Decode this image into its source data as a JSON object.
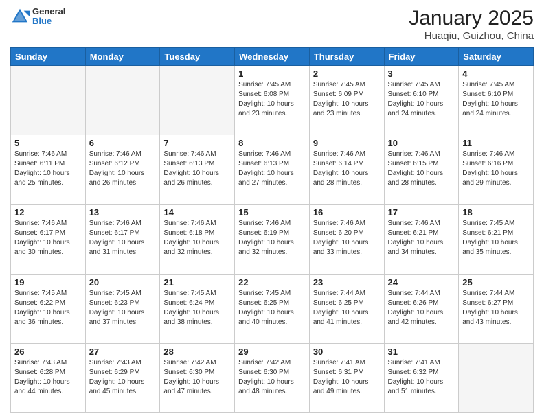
{
  "header": {
    "logo_general": "General",
    "logo_blue": "Blue",
    "title": "January 2025",
    "subtitle": "Huaqiu, Guizhou, China"
  },
  "days_of_week": [
    "Sunday",
    "Monday",
    "Tuesday",
    "Wednesday",
    "Thursday",
    "Friday",
    "Saturday"
  ],
  "weeks": [
    [
      {
        "day": "",
        "empty": true
      },
      {
        "day": "",
        "empty": true
      },
      {
        "day": "",
        "empty": true
      },
      {
        "day": "1",
        "info": "Sunrise: 7:45 AM\nSunset: 6:08 PM\nDaylight: 10 hours\nand 23 minutes."
      },
      {
        "day": "2",
        "info": "Sunrise: 7:45 AM\nSunset: 6:09 PM\nDaylight: 10 hours\nand 23 minutes."
      },
      {
        "day": "3",
        "info": "Sunrise: 7:45 AM\nSunset: 6:10 PM\nDaylight: 10 hours\nand 24 minutes."
      },
      {
        "day": "4",
        "info": "Sunrise: 7:45 AM\nSunset: 6:10 PM\nDaylight: 10 hours\nand 24 minutes."
      }
    ],
    [
      {
        "day": "5",
        "info": "Sunrise: 7:46 AM\nSunset: 6:11 PM\nDaylight: 10 hours\nand 25 minutes."
      },
      {
        "day": "6",
        "info": "Sunrise: 7:46 AM\nSunset: 6:12 PM\nDaylight: 10 hours\nand 26 minutes."
      },
      {
        "day": "7",
        "info": "Sunrise: 7:46 AM\nSunset: 6:13 PM\nDaylight: 10 hours\nand 26 minutes."
      },
      {
        "day": "8",
        "info": "Sunrise: 7:46 AM\nSunset: 6:13 PM\nDaylight: 10 hours\nand 27 minutes."
      },
      {
        "day": "9",
        "info": "Sunrise: 7:46 AM\nSunset: 6:14 PM\nDaylight: 10 hours\nand 28 minutes."
      },
      {
        "day": "10",
        "info": "Sunrise: 7:46 AM\nSunset: 6:15 PM\nDaylight: 10 hours\nand 28 minutes."
      },
      {
        "day": "11",
        "info": "Sunrise: 7:46 AM\nSunset: 6:16 PM\nDaylight: 10 hours\nand 29 minutes."
      }
    ],
    [
      {
        "day": "12",
        "info": "Sunrise: 7:46 AM\nSunset: 6:17 PM\nDaylight: 10 hours\nand 30 minutes."
      },
      {
        "day": "13",
        "info": "Sunrise: 7:46 AM\nSunset: 6:17 PM\nDaylight: 10 hours\nand 31 minutes."
      },
      {
        "day": "14",
        "info": "Sunrise: 7:46 AM\nSunset: 6:18 PM\nDaylight: 10 hours\nand 32 minutes."
      },
      {
        "day": "15",
        "info": "Sunrise: 7:46 AM\nSunset: 6:19 PM\nDaylight: 10 hours\nand 32 minutes."
      },
      {
        "day": "16",
        "info": "Sunrise: 7:46 AM\nSunset: 6:20 PM\nDaylight: 10 hours\nand 33 minutes."
      },
      {
        "day": "17",
        "info": "Sunrise: 7:46 AM\nSunset: 6:21 PM\nDaylight: 10 hours\nand 34 minutes."
      },
      {
        "day": "18",
        "info": "Sunrise: 7:45 AM\nSunset: 6:21 PM\nDaylight: 10 hours\nand 35 minutes."
      }
    ],
    [
      {
        "day": "19",
        "info": "Sunrise: 7:45 AM\nSunset: 6:22 PM\nDaylight: 10 hours\nand 36 minutes."
      },
      {
        "day": "20",
        "info": "Sunrise: 7:45 AM\nSunset: 6:23 PM\nDaylight: 10 hours\nand 37 minutes."
      },
      {
        "day": "21",
        "info": "Sunrise: 7:45 AM\nSunset: 6:24 PM\nDaylight: 10 hours\nand 38 minutes."
      },
      {
        "day": "22",
        "info": "Sunrise: 7:45 AM\nSunset: 6:25 PM\nDaylight: 10 hours\nand 40 minutes."
      },
      {
        "day": "23",
        "info": "Sunrise: 7:44 AM\nSunset: 6:25 PM\nDaylight: 10 hours\nand 41 minutes."
      },
      {
        "day": "24",
        "info": "Sunrise: 7:44 AM\nSunset: 6:26 PM\nDaylight: 10 hours\nand 42 minutes."
      },
      {
        "day": "25",
        "info": "Sunrise: 7:44 AM\nSunset: 6:27 PM\nDaylight: 10 hours\nand 43 minutes."
      }
    ],
    [
      {
        "day": "26",
        "info": "Sunrise: 7:43 AM\nSunset: 6:28 PM\nDaylight: 10 hours\nand 44 minutes."
      },
      {
        "day": "27",
        "info": "Sunrise: 7:43 AM\nSunset: 6:29 PM\nDaylight: 10 hours\nand 45 minutes."
      },
      {
        "day": "28",
        "info": "Sunrise: 7:42 AM\nSunset: 6:30 PM\nDaylight: 10 hours\nand 47 minutes."
      },
      {
        "day": "29",
        "info": "Sunrise: 7:42 AM\nSunset: 6:30 PM\nDaylight: 10 hours\nand 48 minutes."
      },
      {
        "day": "30",
        "info": "Sunrise: 7:41 AM\nSunset: 6:31 PM\nDaylight: 10 hours\nand 49 minutes."
      },
      {
        "day": "31",
        "info": "Sunrise: 7:41 AM\nSunset: 6:32 PM\nDaylight: 10 hours\nand 51 minutes."
      },
      {
        "day": "",
        "empty": true
      }
    ]
  ]
}
